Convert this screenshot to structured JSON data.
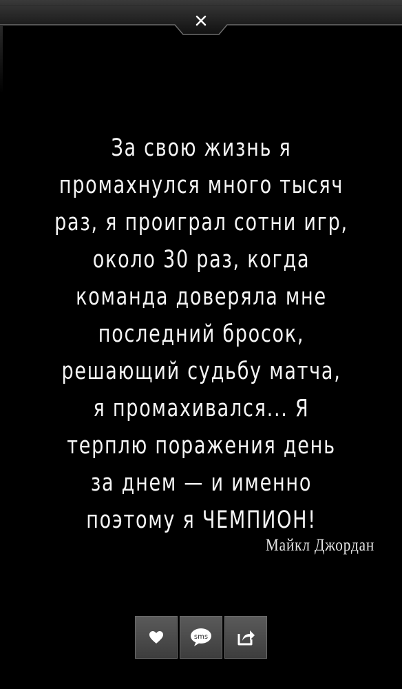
{
  "header": {
    "close_icon": "close-icon"
  },
  "quote": {
    "text": "За свою жизнь я\nпромахнулся много тысяч\nраз, я проиграл сотни игр,\nоколо 30 раз, когда\nкоманда доверяла мне\nпоследний бросок,\nрешающий судьбу матча,\nя промахивался... Я\nтерплю поражения день\nза днем — и именно\nпоэтому я ЧЕМПИОН!",
    "author": "Майкл Джордан"
  },
  "actions": {
    "like_icon": "heart-icon",
    "sms_label": "sms",
    "share_icon": "share-icon"
  },
  "colors": {
    "background": "#000000",
    "text": "#f4f4f4",
    "button": "#4a4a4a"
  }
}
